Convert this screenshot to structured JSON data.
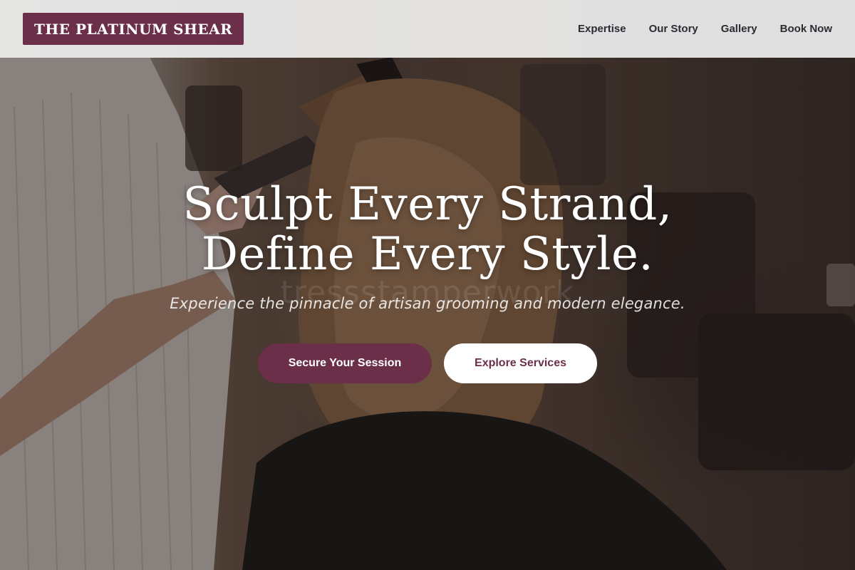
{
  "brand": {
    "name": "THE PLATINUM SHEAR",
    "color": "#6b2f4a"
  },
  "nav": {
    "items": [
      {
        "label": "Expertise"
      },
      {
        "label": "Our Story"
      },
      {
        "label": "Gallery"
      },
      {
        "label": "Book Now"
      }
    ]
  },
  "hero": {
    "headline_line1": "Sculpt Every Strand,",
    "headline_line2": "Define Every Style.",
    "tagline": "Experience the pinnacle of artisan grooming and modern elegance.",
    "watermark": "tressstamperwork",
    "primary_cta": "Secure Your Session",
    "secondary_cta": "Explore Services",
    "image_description": "stylist curling a client's long wavy hair in a salon"
  }
}
